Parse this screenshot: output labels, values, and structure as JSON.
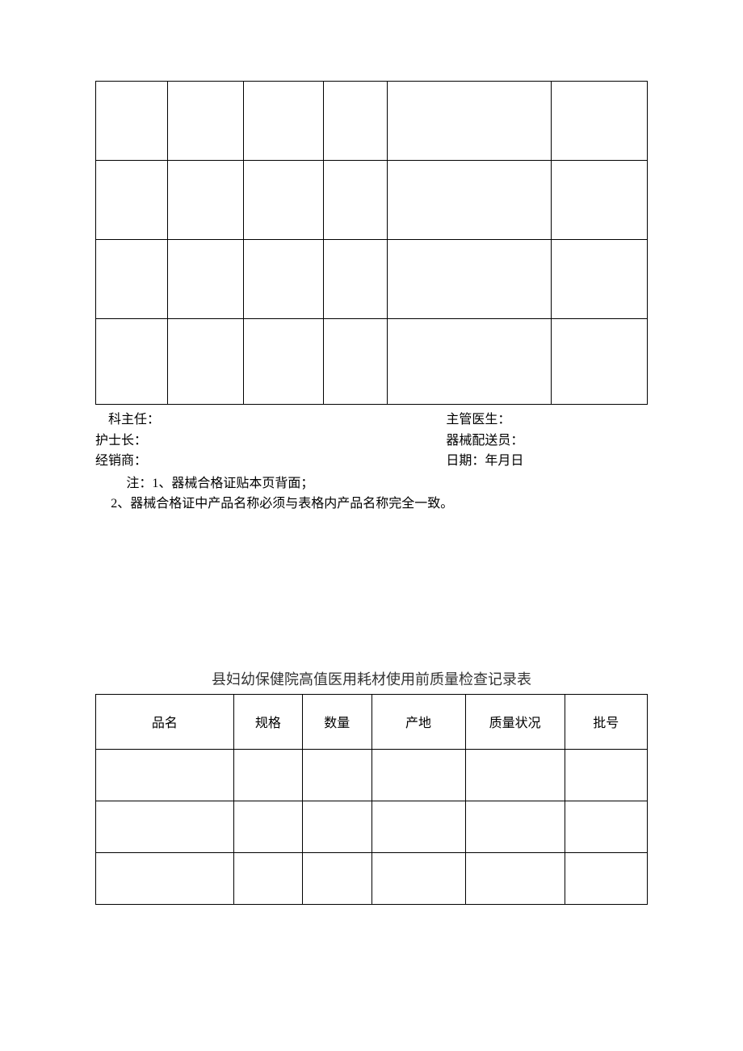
{
  "signatures": {
    "dept_head_label": "科主任：",
    "attending_label": "主管医生：",
    "head_nurse_label": "护士长：",
    "delivery_label": "器械配送员：",
    "dealer_label": "经销商：",
    "date_label": "日期：年月日"
  },
  "notes": {
    "line1": "注：1、器械合格证贴本页背面；",
    "line2": "2、器械合格证中产品名称必须与表格内产品名称完全一致。"
  },
  "table2": {
    "title": "县妇幼保健院高值医用耗材使用前质量检查记录表",
    "headers": {
      "name": "品名",
      "spec": "规格",
      "qty": "数量",
      "origin": "产地",
      "quality": "质量状况",
      "batch": "批号"
    }
  }
}
